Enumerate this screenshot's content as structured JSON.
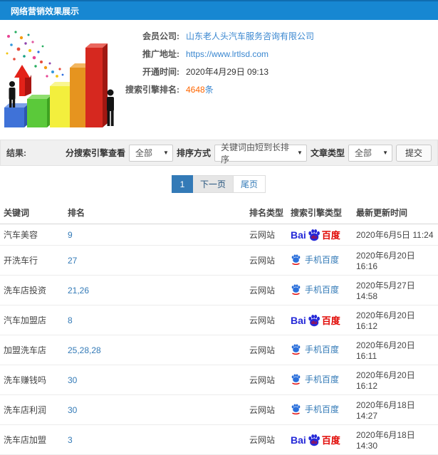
{
  "header": {
    "title": "网络营销效果展示"
  },
  "info": {
    "rows": [
      {
        "label": "会员公司:",
        "value": "山东老人头汽车服务咨询有限公司"
      },
      {
        "label": "推广地址:",
        "value": "https://www.lrtlsd.com"
      },
      {
        "label": "开通时间:",
        "value": "2020年4月29日 09:13"
      },
      {
        "label": "搜索引擎排名:",
        "value": "4648",
        "suffix": "条"
      }
    ]
  },
  "filter": {
    "result_label": "结果:",
    "engine_label": "分搜索引擎查看",
    "engine_value": "全部",
    "sort_label": "排序方式",
    "sort_value": "关键词由短到长排序",
    "article_label": "文章类型",
    "article_value": "全部",
    "caret": "▼",
    "submit_label": "提交"
  },
  "pagination": {
    "current": "1",
    "next": "下一页",
    "last": "尾页"
  },
  "table": {
    "headers": [
      "关键词",
      "排名",
      "排名类型",
      "搜索引擎类型",
      "最新更新时间"
    ],
    "engine_types": {
      "baidu": {
        "bai": "Bai",
        "du": "du",
        "cn": "百度"
      },
      "mobile": {
        "label": "手机百度"
      }
    },
    "rows": [
      {
        "keyword": "汽车美容",
        "rank": "9",
        "rank_type": "云网站",
        "engine": "baidu",
        "time": "2020年6月5日 11:24"
      },
      {
        "keyword": "开洗车行",
        "rank": "27",
        "rank_type": "云网站",
        "engine": "mobile-baidu",
        "time": "2020年6月20日 16:16"
      },
      {
        "keyword": "洗车店投资",
        "rank": "21,26",
        "rank_type": "云网站",
        "engine": "mobile-baidu",
        "time": "2020年5月27日 14:58"
      },
      {
        "keyword": "汽车加盟店",
        "rank": "8",
        "rank_type": "云网站",
        "engine": "baidu",
        "time": "2020年6月20日 16:12"
      },
      {
        "keyword": "加盟洗车店",
        "rank": "25,28,28",
        "rank_type": "云网站",
        "engine": "mobile-baidu",
        "time": "2020年6月20日 16:11"
      },
      {
        "keyword": "洗车赚钱吗",
        "rank": "30",
        "rank_type": "云网站",
        "engine": "mobile-baidu",
        "time": "2020年6月20日 16:12"
      },
      {
        "keyword": "洗车店利润",
        "rank": "30",
        "rank_type": "云网站",
        "engine": "mobile-baidu",
        "time": "2020年6月18日 14:27"
      },
      {
        "keyword": "洗车店加盟",
        "rank": "3",
        "rank_type": "云网站",
        "engine": "baidu",
        "time": "2020年6月18日 14:30"
      }
    ]
  },
  "colors": {
    "header_blue": "#1787d2",
    "link_blue": "#3a87d0",
    "accent_blue": "#337ab7",
    "highlight_orange": "#ff6600",
    "baidu_blue": "#2529d8",
    "baidu_red": "#e10602"
  }
}
